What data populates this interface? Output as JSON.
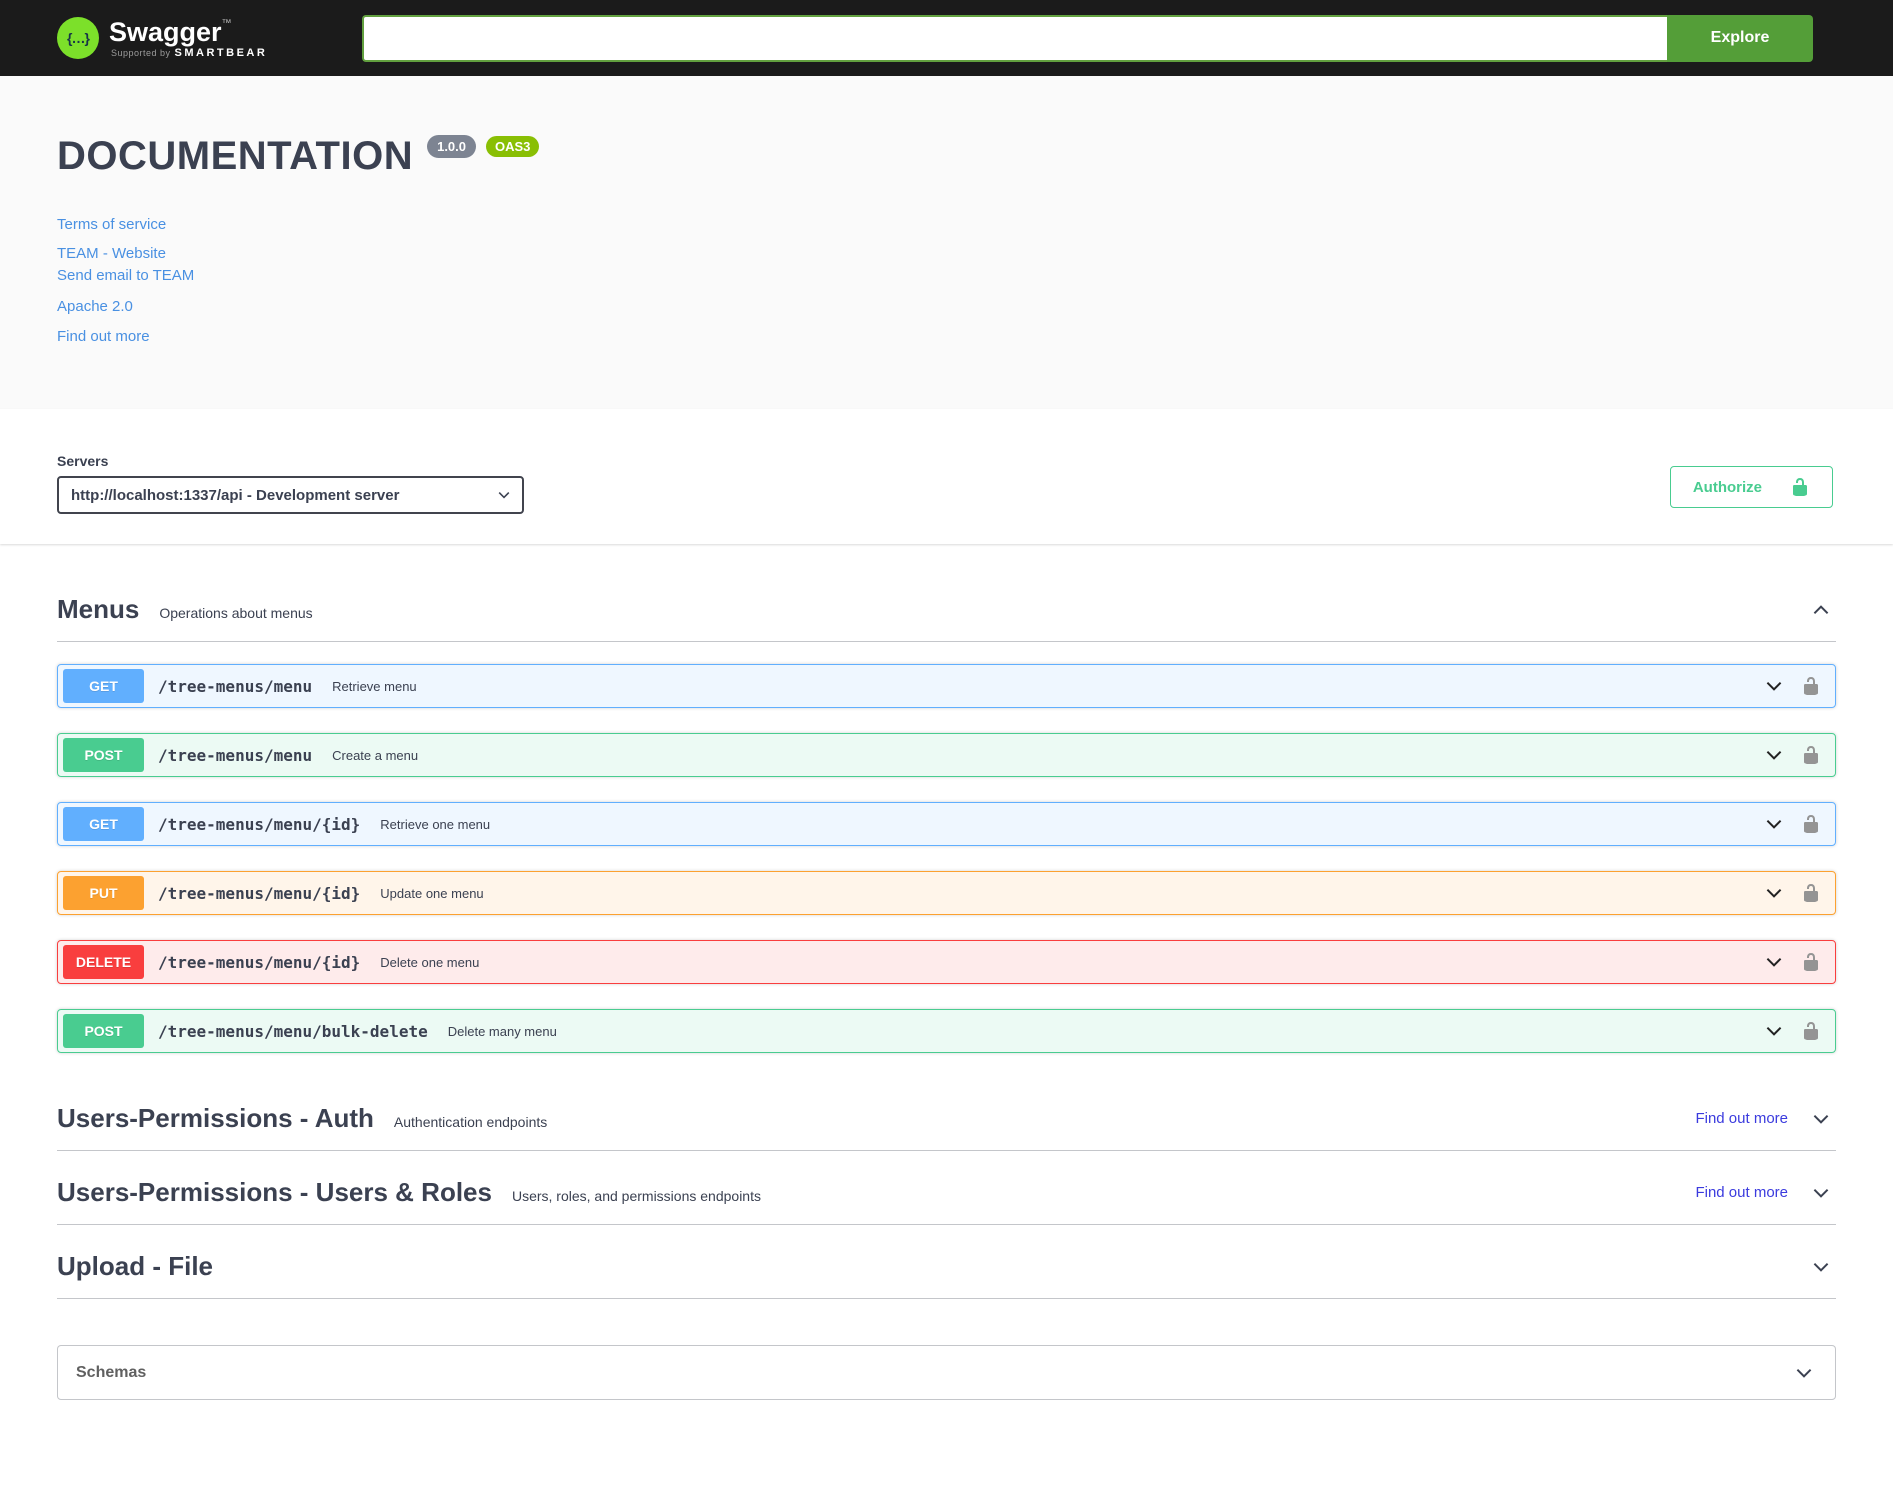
{
  "topbar": {
    "logo_glyph": "{…}",
    "brand": "Swagger",
    "brand_trademark": "™",
    "supported_by": "Supported by",
    "supported_by_brand": "SMARTBEAR",
    "search_value": "",
    "explore_button": "Explore"
  },
  "info": {
    "title": "DOCUMENTATION",
    "version_badge": "1.0.0",
    "spec_badge": "OAS3",
    "links": [
      {
        "label": "Terms of service"
      },
      {
        "label": "TEAM - Website"
      },
      {
        "label": "Send email to TEAM"
      },
      {
        "label": "Apache 2.0"
      },
      {
        "label": "Find out more"
      }
    ]
  },
  "servers": {
    "label": "Servers",
    "selected_option": "http://localhost:1337/api - Development server"
  },
  "auth": {
    "authorize_button": "Authorize"
  },
  "sections": [
    {
      "title": "Menus",
      "description": "Operations about menus",
      "state": "expanded"
    },
    {
      "title": "Users-Permissions - Auth",
      "description": "Authentication endpoints",
      "external_link": "Find out more",
      "state": "collapsed"
    },
    {
      "title": "Users-Permissions - Users & Roles",
      "description": "Users, roles, and permissions endpoints",
      "external_link": "Find out more",
      "state": "collapsed"
    },
    {
      "title": "Upload - File",
      "description": "",
      "state": "collapsed"
    }
  ],
  "operations": [
    {
      "method": "GET",
      "path": "/tree-menus/menu",
      "summary": "Retrieve menu"
    },
    {
      "method": "POST",
      "path": "/tree-menus/menu",
      "summary": "Create a menu"
    },
    {
      "method": "GET",
      "path": "/tree-menus/menu/{id}",
      "summary": "Retrieve one menu"
    },
    {
      "method": "PUT",
      "path": "/tree-menus/menu/{id}",
      "summary": "Update one menu"
    },
    {
      "method": "DELETE",
      "path": "/tree-menus/menu/{id}",
      "summary": "Delete one menu"
    },
    {
      "method": "POST",
      "path": "/tree-menus/menu/bulk-delete",
      "summary": "Delete many menu"
    }
  ],
  "models": {
    "title": "Schemas"
  },
  "colors": {
    "topbar_bg": "#1b1b1b",
    "explore_green": "#549e38",
    "logo_green": "#7ce02a",
    "get_blue": "#61affe",
    "post_green": "#49cc90",
    "put_orange": "#fca130",
    "delete_red": "#f93e3e",
    "authorize_green": "#49cc90",
    "info_link_blue": "#4990e2",
    "external_link_blue": "#3b3bde",
    "version_badge_gray": "#7d8492",
    "oas_badge_green": "#89bf04",
    "heading_gray": "#3b4151"
  }
}
